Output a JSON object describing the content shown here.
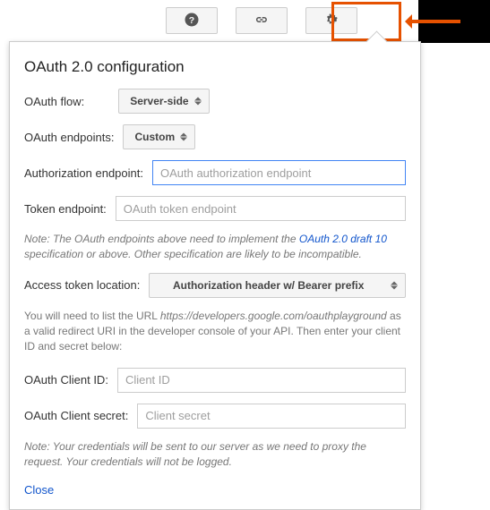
{
  "toolbar": {
    "help_icon": "help",
    "link_icon": "link",
    "gear_icon": "settings"
  },
  "panel": {
    "title": "OAuth 2.0 configuration",
    "oauth_flow": {
      "label": "OAuth flow:",
      "value": "Server-side"
    },
    "oauth_endpoints": {
      "label": "OAuth endpoints:",
      "value": "Custom"
    },
    "auth_endpoint": {
      "label": "Authorization endpoint:",
      "placeholder": "OAuth authorization endpoint",
      "value": ""
    },
    "token_endpoint": {
      "label": "Token endpoint:",
      "placeholder": "OAuth token endpoint",
      "value": ""
    },
    "note1_prefix": "Note: The OAuth endpoints above need to implement the ",
    "note1_link": "OAuth 2.0 draft 10",
    "note1_suffix": " specification or above. Other specification are likely to be incompatible.",
    "access_token_location": {
      "label": "Access token location:",
      "value": "Authorization header w/ Bearer prefix"
    },
    "redirect_info_prefix": "You will need to list the URL ",
    "redirect_info_url": "https://developers.google.com/oauthplayground",
    "redirect_info_suffix": " as a valid redirect URI in the developer console of your API. Then enter your client ID and secret below:",
    "client_id": {
      "label": "OAuth Client ID:",
      "placeholder": "Client ID",
      "value": ""
    },
    "client_secret": {
      "label": "OAuth Client secret:",
      "placeholder": "Client secret",
      "value": ""
    },
    "note2": "Note: Your credentials will be sent to our server as we need to proxy the request. Your credentials will not be logged.",
    "close": "Close"
  }
}
